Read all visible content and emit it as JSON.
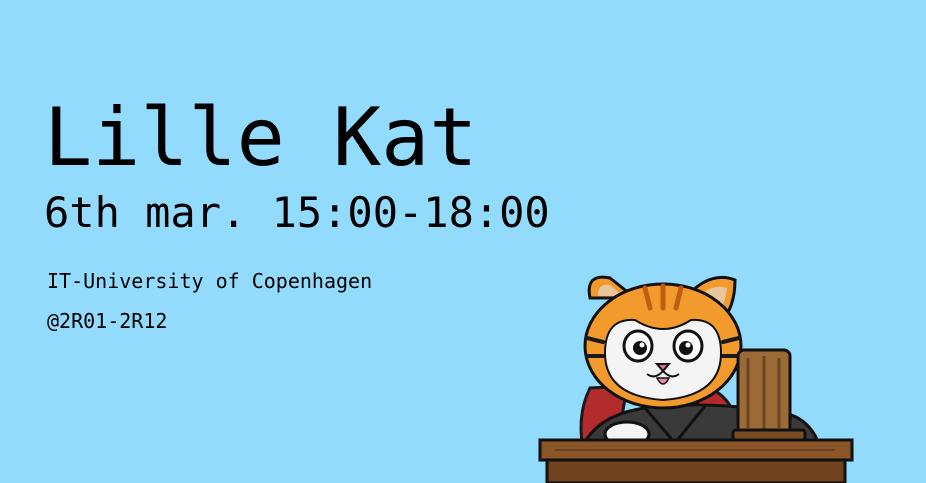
{
  "event": {
    "title": "Lille Kat",
    "datetime": "6th mar. 15:00-18:00",
    "venue": "IT-University of Copenhagen",
    "room": "@2R01-2R12"
  },
  "colors": {
    "background": "#93dbfd",
    "text": "#000000",
    "cat_orange": "#f29a2c",
    "cat_stripe": "#c05d15",
    "robe": "#3a3a3a",
    "collar": "#b32b2b",
    "wood": "#9b6a36",
    "desk": "#8a5528"
  },
  "illustration": {
    "icon": "judge-cat-mascot-icon"
  }
}
